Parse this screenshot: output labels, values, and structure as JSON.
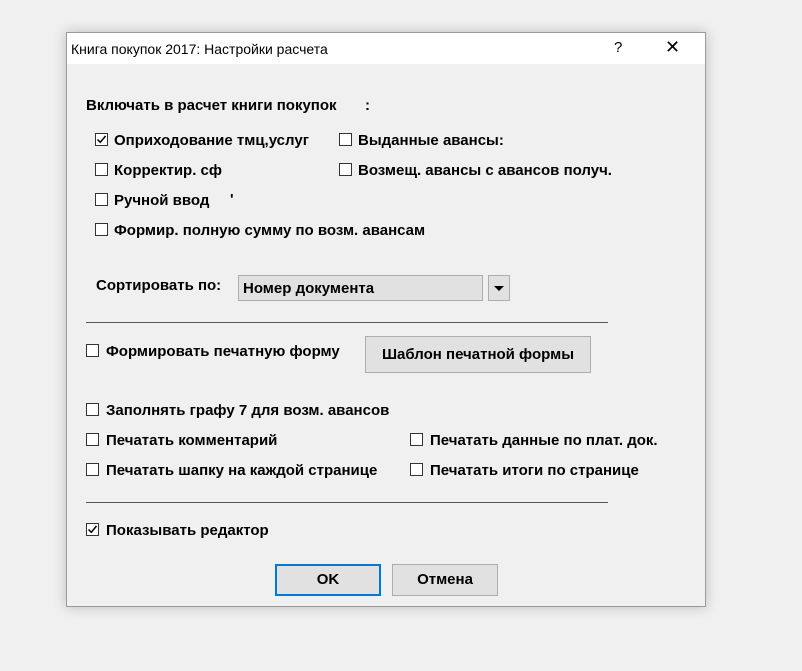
{
  "window": {
    "title": "Книга покупок 2017: Настройки расчета",
    "help_glyph": "?",
    "close_glyph": "✕"
  },
  "section_include": {
    "heading": "Включать в расчет книги покупок",
    "heading_suffix": ":",
    "options": [
      {
        "label": "Оприходование тмц,услуг",
        "checked": true
      },
      {
        "label": "Выданные авансы:",
        "checked": false
      },
      {
        "label": "Корректир. сф",
        "checked": false
      },
      {
        "label": "Возмещ. авансы с авансов получ.",
        "checked": false
      },
      {
        "label": "Ручной ввод",
        "checked": false
      },
      {
        "label": "Формир. полную сумму  по возм. авансам",
        "checked": false
      }
    ],
    "stray_mark": "'"
  },
  "sort": {
    "label": "Сортировать по:",
    "selected": "Номер документа"
  },
  "print": {
    "form_label": "Формировать печатную форму",
    "form_checked": false,
    "template_button": "Шаблон печатной формы",
    "options": [
      {
        "label": "Заполнять графу 7 для возм. авансов",
        "checked": false
      },
      {
        "label": "Печатать комментарий",
        "checked": false
      },
      {
        "label": "Печатать данные по плат. док.",
        "checked": false
      },
      {
        "label": "Печатать шапку на каждой странице",
        "checked": false
      },
      {
        "label": "Печатать итоги по странице",
        "checked": false
      }
    ]
  },
  "show_editor": {
    "label": "Показывать редактор",
    "checked": true
  },
  "buttons": {
    "ok": "OK",
    "cancel": "Отмена"
  },
  "colors": {
    "accent": "#0078d7",
    "dialog_bg": "#f0f0f0",
    "titlebar_bg": "#ffffff",
    "button_bg": "#e1e1e1"
  },
  "icons": {
    "check": "check-icon",
    "dropdown": "chevron-down-icon",
    "close": "close-icon",
    "help": "help-icon"
  }
}
